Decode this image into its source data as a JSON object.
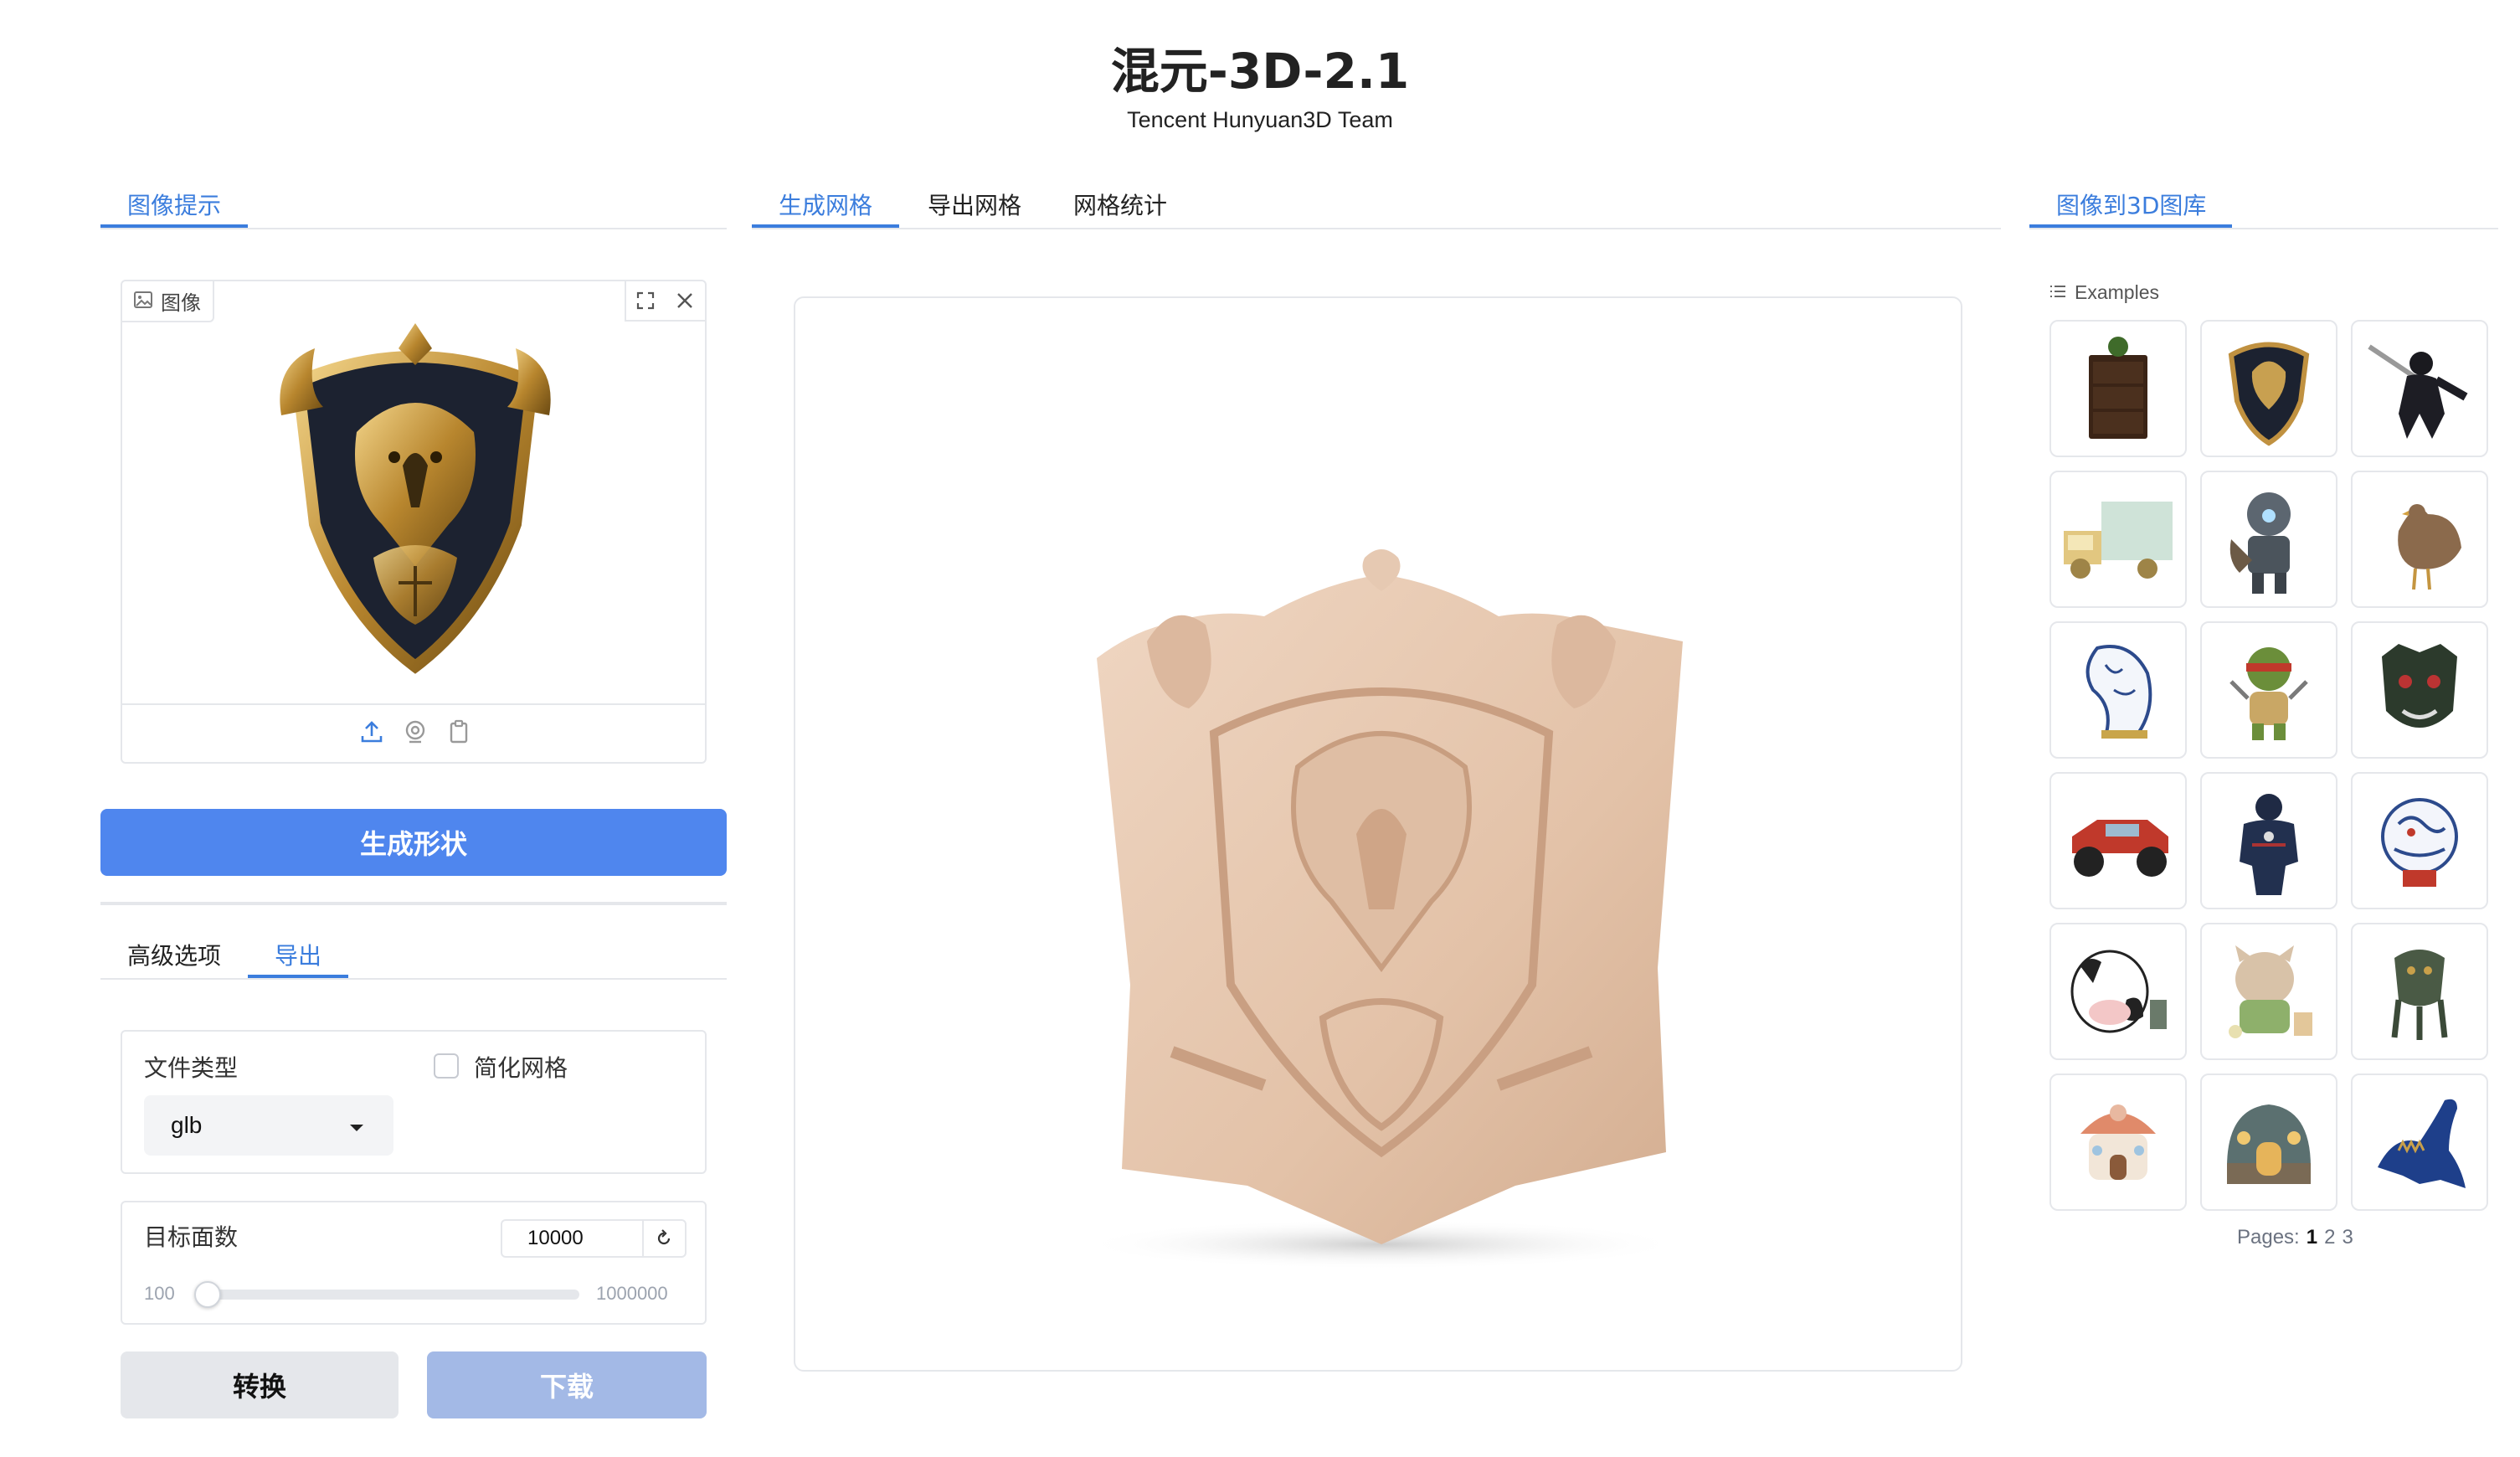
{
  "header": {
    "title": "混元-3D-2.1",
    "subtitle": "Tencent Hunyuan3D Team"
  },
  "left_panel": {
    "tab": "图像提示",
    "image_label": "图像",
    "generate_button": "生成形状",
    "options_tabs": [
      "高级选项",
      "导出"
    ],
    "active_options_tab": 1,
    "file_type_label": "文件类型",
    "file_type_value": "glb",
    "simplify_label": "简化网格",
    "simplify_checked": false,
    "target_faces_label": "目标面数",
    "target_faces_value": "10000",
    "slider_min": "100",
    "slider_max": "1000000",
    "convert_button": "转换",
    "download_button": "下载"
  },
  "center_panel": {
    "tabs": [
      "生成网格",
      "导出网格",
      "网格统计"
    ],
    "active_tab": 0
  },
  "right_panel": {
    "tab": "图像到3D图库",
    "examples_label": "Examples",
    "gallery": [
      "dresser",
      "eagle-shield",
      "ninja-warrior",
      "golden-truck",
      "armored-robot",
      "hen",
      "porcelain-horse-head",
      "ninja-turtle",
      "demon-mask",
      "red-monster-truck",
      "armored-hero",
      "porcelain-dragon",
      "cartoon-cow",
      "cartoon-horse",
      "bronze-ding",
      "mushroom-house",
      "fairy-house",
      "blue-dinosaur"
    ],
    "pages_label": "Pages:",
    "pages": [
      "1",
      "2",
      "3"
    ],
    "current_page": "1"
  },
  "colors": {
    "accent": "#3b7ddd",
    "primary_button": "#4f86ee",
    "disabled_button": "#a3b9e6",
    "model_tone": "#e8cbb2"
  }
}
